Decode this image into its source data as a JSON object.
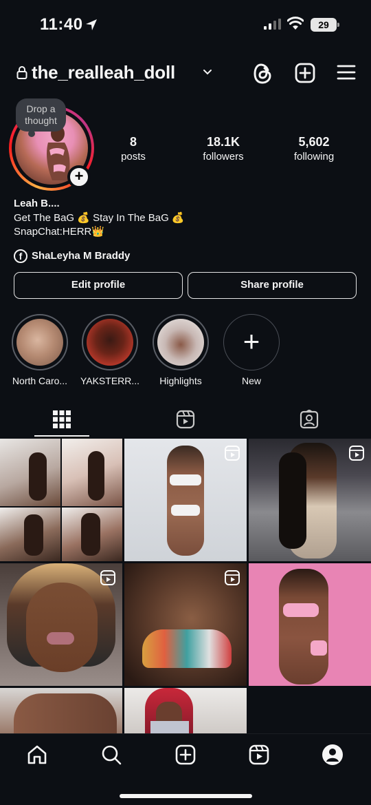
{
  "status_bar": {
    "time": "11:40",
    "battery": "29"
  },
  "header": {
    "username": "the_realleah_doll"
  },
  "profile": {
    "note": "Drop a thought",
    "stats": {
      "posts_count": "8",
      "posts_label": "posts",
      "followers_count": "18.1K",
      "followers_label": "followers",
      "following_count": "5,602",
      "following_label": "following"
    },
    "name": "Leah B....",
    "bio_line1": "Get The BaG 💰 Stay In The BaG 💰",
    "bio_line2": "SnapChat:HERR👑",
    "facebook_link": "ShaLeyha M Braddy"
  },
  "buttons": {
    "edit_profile": "Edit profile",
    "share_profile": "Share profile"
  },
  "highlights": [
    {
      "label": "North Caro..."
    },
    {
      "label": "YAKSTERR..."
    },
    {
      "label": "Highlights"
    },
    {
      "label": "New"
    }
  ],
  "tabs": [
    {
      "icon": "grid-icon",
      "active": true
    },
    {
      "icon": "reels-icon",
      "active": false
    },
    {
      "icon": "tagged-icon",
      "active": false
    }
  ],
  "grid": [
    {
      "type": "collage"
    },
    {
      "type": "photo",
      "reel": true
    },
    {
      "type": "photo",
      "reel": true
    },
    {
      "type": "photo",
      "reel": true
    },
    {
      "type": "photo",
      "reel": true
    },
    {
      "type": "photo",
      "reel": false
    },
    {
      "type": "photo",
      "reel": false
    },
    {
      "type": "photo",
      "reel": false
    }
  ],
  "bottom_nav": [
    "home-icon",
    "search-icon",
    "create-icon",
    "reels-icon",
    "profile-icon"
  ],
  "colors": {
    "background": "#0c0f14",
    "text": "#f5f5f5",
    "story_ring_start": "#fcb045",
    "story_ring_end": "#c13584"
  }
}
